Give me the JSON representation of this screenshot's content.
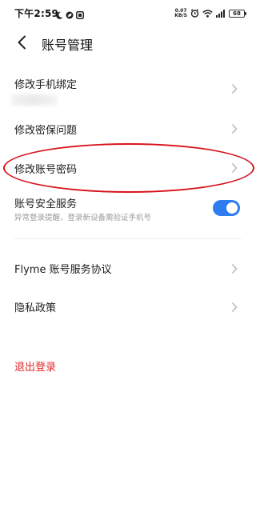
{
  "status_bar": {
    "time": "下午2:59",
    "net_speed_value": "0.07",
    "net_speed_unit": "KB/S",
    "battery": "68",
    "left_icons": [
      "moon-icon",
      "leaf-icon",
      "notification-icon"
    ],
    "right_icons": [
      "alarm-icon",
      "wifi-icon",
      "signal-icon"
    ]
  },
  "header": {
    "title": "账号管理",
    "back_icon": "back-arrow-icon"
  },
  "rows": {
    "change_phone": "修改手机绑定",
    "security_question": "修改密保问题",
    "change_password": "修改账号密码",
    "account_security": {
      "label": "账号安全服务",
      "subtitle": "异常登录提醒、登录新设备需验证手机号",
      "enabled": true
    },
    "agreement": "Flyme 账号服务协议",
    "privacy": "隐私政策"
  },
  "logout": {
    "label": "退出登录"
  },
  "colors": {
    "accent_blue": "#2f7bf0",
    "logout_red": "#e02828",
    "annotation_red": "#d8131b"
  }
}
